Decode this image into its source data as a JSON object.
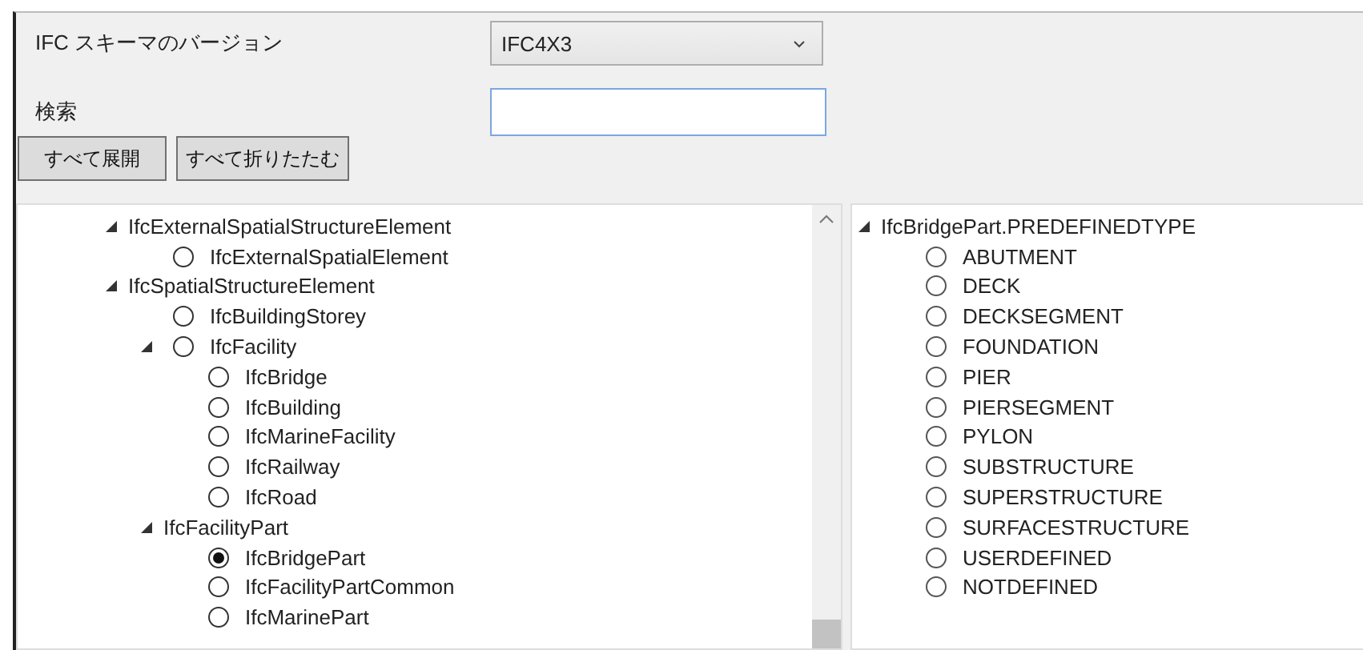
{
  "schema_version": {
    "label": "IFC スキーマのバージョン",
    "value": "IFC4X3"
  },
  "search": {
    "label": "検索"
  },
  "buttons": [
    "すべて展開",
    "すべて折りたたむ"
  ],
  "class_tree": [
    {
      "label": "IfcExternalSpatialStructureElement",
      "kind": "group",
      "expanded": true,
      "children": [
        {
          "label": "IfcExternalSpatialElement",
          "kind": "option",
          "selected": false
        }
      ]
    },
    {
      "label": "IfcSpatialStructureElement",
      "kind": "group",
      "expanded": true,
      "children": [
        {
          "label": "IfcBuildingStorey",
          "kind": "option",
          "selected": false
        },
        {
          "label": "IfcFacility",
          "kind": "option",
          "selected": false,
          "expanded": true,
          "children": [
            {
              "label": "IfcBridge",
              "kind": "option",
              "selected": false
            },
            {
              "label": "IfcBuilding",
              "kind": "option",
              "selected": false
            },
            {
              "label": "IfcMarineFacility",
              "kind": "option",
              "selected": false
            },
            {
              "label": "IfcRailway",
              "kind": "option",
              "selected": false
            },
            {
              "label": "IfcRoad",
              "kind": "option",
              "selected": false
            }
          ]
        },
        {
          "label": "IfcFacilityPart",
          "kind": "group",
          "expanded": true,
          "children": [
            {
              "label": "IfcBridgePart",
              "kind": "option",
              "selected": true
            },
            {
              "label": "IfcFacilityPartCommon",
              "kind": "option",
              "selected": false
            },
            {
              "label": "IfcMarinePart",
              "kind": "option",
              "selected": false
            }
          ]
        }
      ]
    }
  ],
  "type_tree": [
    {
      "label": "IfcBridgePart.PREDEFINEDTYPE",
      "kind": "group",
      "expanded": true,
      "children": [
        {
          "label": "ABUTMENT",
          "kind": "option",
          "selected": false
        },
        {
          "label": "DECK",
          "kind": "option",
          "selected": false
        },
        {
          "label": "DECKSEGMENT",
          "kind": "option",
          "selected": false
        },
        {
          "label": "FOUNDATION",
          "kind": "option",
          "selected": false
        },
        {
          "label": "PIER",
          "kind": "option",
          "selected": false
        },
        {
          "label": "PIERSEGMENT",
          "kind": "option",
          "selected": false
        },
        {
          "label": "PYLON",
          "kind": "option",
          "selected": false
        },
        {
          "label": "SUBSTRUCTURE",
          "kind": "option",
          "selected": false
        },
        {
          "label": "SUPERSTRUCTURE",
          "kind": "option",
          "selected": false
        },
        {
          "label": "SURFACESTRUCTURE",
          "kind": "option",
          "selected": false
        },
        {
          "label": "USERDEFINED",
          "kind": "option",
          "selected": false
        },
        {
          "label": "NOTDEFINED",
          "kind": "option",
          "selected": false
        }
      ]
    }
  ]
}
